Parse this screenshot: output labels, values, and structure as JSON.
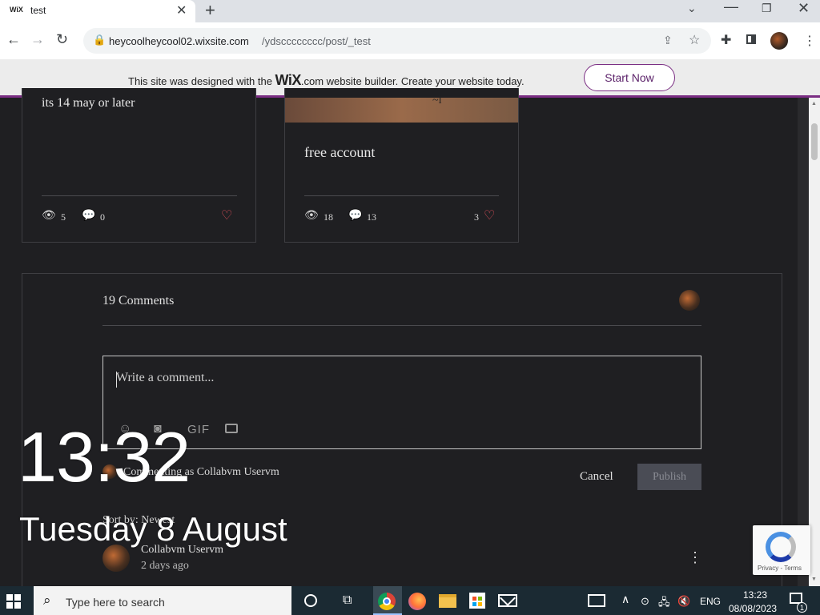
{
  "browser": {
    "tab_favicon": "WiX",
    "tab_title": "test",
    "tab_close": "✕",
    "new_tab": "+",
    "url_host": "heycoolheycool02.wixsite.com",
    "url_path": "/ydscccccccc/post/_test"
  },
  "wix_banner": {
    "text_before": "This site was designed with the ",
    "brand": "WiX",
    "text_after": ".com website builder. Create your website today.",
    "cta": "Start Now"
  },
  "cards": [
    {
      "text": "its 14 may or later",
      "views": "5",
      "comments": "0",
      "likes": ""
    },
    {
      "title": "free account",
      "image_mark": "~l",
      "views": "18",
      "comments": "13",
      "likes": "3"
    }
  ],
  "comments": {
    "count_label": "19 Comments",
    "input_placeholder": "Write a comment...",
    "gif_label": "GIF",
    "commenting_as": "Commenting as Collabvm Uservm",
    "cancel": "Cancel",
    "publish": "Publish",
    "sort_label": "Sort by: Newest",
    "items": [
      {
        "author": "Collabvm Uservm",
        "time": "2 days ago"
      }
    ]
  },
  "lock_overlay": {
    "time": "13:32",
    "date": "Tuesday 8 August"
  },
  "recaptcha": {
    "text": "Privacy - Terms"
  },
  "taskbar": {
    "search_placeholder": "Type here to search",
    "language": "ENG",
    "time": "13:23",
    "date": "08/08/2023",
    "notification_count": "1"
  },
  "colors": {
    "page_bg": "#1f1f22",
    "wix_accent": "#7a2d83",
    "heart": "#e0505a",
    "taskbar": "#1b2a33"
  }
}
